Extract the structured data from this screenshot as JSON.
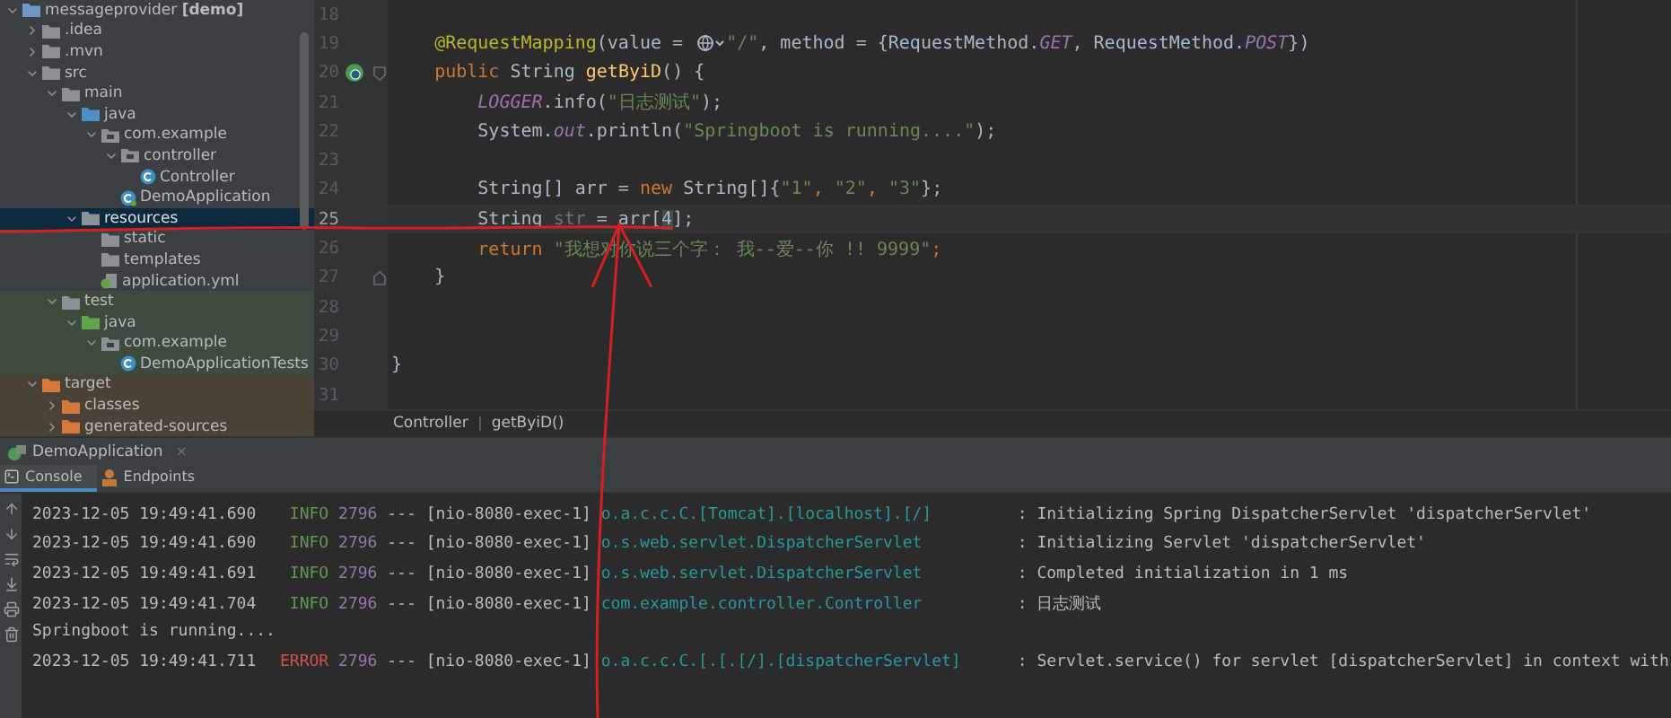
{
  "project_tree": [
    {
      "label": "messageprovider **[demo]**",
      "kind": "module",
      "expanded": true,
      "selected": false,
      "children": [
        {
          "label": ".idea",
          "kind": "folder",
          "expanded": false,
          "selected": false
        },
        {
          "label": ".mvn",
          "kind": "folder",
          "expanded": false,
          "selected": false
        },
        {
          "label": "src",
          "kind": "folder",
          "expanded": true,
          "selected": false,
          "children": [
            {
              "label": "main",
              "kind": "folder",
              "expanded": true,
              "selected": false,
              "children": [
                {
                  "label": "java",
                  "kind": "source-folder",
                  "expanded": true,
                  "selected": false,
                  "children": [
                    {
                      "label": "com.example",
                      "kind": "package",
                      "expanded": true,
                      "selected": false,
                      "children": [
                        {
                          "label": "controller",
                          "kind": "package",
                          "expanded": true,
                          "selected": false,
                          "children": [
                            {
                              "label": "Controller",
                              "kind": "class",
                              "selected": false
                            }
                          ]
                        },
                        {
                          "label": "DemoApplication",
                          "kind": "app-class",
                          "selected": false
                        }
                      ]
                    }
                  ]
                },
                {
                  "label": "resources",
                  "kind": "resource-folder",
                  "expanded": true,
                  "selected": true,
                  "children": [
                    {
                      "label": "static",
                      "kind": "folder",
                      "selected": false
                    },
                    {
                      "label": "templates",
                      "kind": "folder",
                      "selected": false
                    },
                    {
                      "label": "application.yml",
                      "kind": "yaml",
                      "selected": false
                    }
                  ]
                }
              ]
            },
            {
              "label": "test",
              "kind": "folder",
              "test_scope": true,
              "expanded": true,
              "selected": false,
              "children": [
                {
                  "label": "java",
                  "kind": "test-folder",
                  "expanded": true,
                  "selected": false,
                  "children": [
                    {
                      "label": "com.example",
                      "kind": "package",
                      "expanded": true,
                      "selected": false,
                      "children": [
                        {
                          "label": "DemoApplicationTests",
                          "kind": "class",
                          "selected": false
                        }
                      ]
                    }
                  ]
                }
              ]
            }
          ]
        },
        {
          "label": "target",
          "kind": "excluded-folder",
          "excluded": true,
          "expanded": true,
          "selected": false,
          "children": [
            {
              "label": "classes",
              "kind": "excluded-folder",
              "expanded": false,
              "selected": false
            },
            {
              "label": "generated-sources",
              "kind": "excluded-folder",
              "expanded": false,
              "selected": false
            }
          ]
        }
      ]
    }
  ],
  "editor": {
    "lines": [
      {
        "number": "18",
        "current": false
      },
      {
        "number": "19",
        "current": false,
        "segments": [
          {
            "kind": "annotation",
            "text": "    @RequestMapping"
          },
          {
            "kind": "plain",
            "text": "(value = "
          },
          {
            "kind": "globe-icon"
          },
          {
            "kind": "string",
            "text": "\"/\""
          },
          {
            "kind": "plain",
            "text": ", method = {RequestMethod."
          },
          {
            "kind": "constant",
            "text": "GET"
          },
          {
            "kind": "plain",
            "text": ", RequestMethod."
          },
          {
            "kind": "constant",
            "text": "POST"
          },
          {
            "kind": "plain",
            "text": "})"
          }
        ]
      },
      {
        "number": "20",
        "current": false,
        "run_icon": true,
        "fold_start": true,
        "segments": [
          {
            "kind": "keyword",
            "text": "    public "
          },
          {
            "kind": "plain",
            "text": "String "
          },
          {
            "kind": "method",
            "text": "getByiD"
          },
          {
            "kind": "plain",
            "text": "() {"
          }
        ]
      },
      {
        "number": "21",
        "current": false,
        "segments": [
          {
            "kind": "constant",
            "text": "        LOGGER"
          },
          {
            "kind": "plain",
            "text": ".info("
          },
          {
            "kind": "string",
            "text": "\"日志测试\""
          },
          {
            "kind": "plain",
            "text": ");"
          }
        ]
      },
      {
        "number": "22",
        "current": false,
        "segments": [
          {
            "kind": "plain",
            "text": "        System."
          },
          {
            "kind": "field",
            "text": "out"
          },
          {
            "kind": "plain",
            "text": ".println("
          },
          {
            "kind": "string",
            "text": "\"Springboot is running....\""
          },
          {
            "kind": "plain",
            "text": ");"
          }
        ]
      },
      {
        "number": "23",
        "current": false
      },
      {
        "number": "24",
        "current": false,
        "segments": [
          {
            "kind": "plain",
            "text": "        String[] arr = "
          },
          {
            "kind": "keyword",
            "text": "new "
          },
          {
            "kind": "plain",
            "text": "String[]{"
          },
          {
            "kind": "string",
            "text": "\"1\""
          },
          {
            "kind": "keyword",
            "text": ", "
          },
          {
            "kind": "string",
            "text": "\"2\""
          },
          {
            "kind": "keyword",
            "text": ", "
          },
          {
            "kind": "string",
            "text": "\"3\""
          },
          {
            "kind": "plain",
            "text": "};"
          }
        ]
      },
      {
        "number": "25",
        "current": true,
        "segments": [
          {
            "kind": "plain",
            "text": "        String "
          },
          {
            "kind": "unused",
            "text": "str"
          },
          {
            "kind": "plain",
            "text": " = arr["
          },
          {
            "kind": "caret",
            "text": "4"
          },
          {
            "kind": "plain",
            "text": "];"
          }
        ]
      },
      {
        "number": "26",
        "current": false,
        "segments": [
          {
            "kind": "keyword",
            "text": "        return "
          },
          {
            "kind": "string",
            "text": "\"我想对你说三个字： 我--爱--你 !! 9999\""
          },
          {
            "kind": "keyword",
            "text": ";"
          }
        ]
      },
      {
        "number": "27",
        "current": false,
        "fold_end": true,
        "segments": [
          {
            "kind": "plain",
            "text": "    }"
          }
        ]
      },
      {
        "number": "28",
        "current": false
      },
      {
        "number": "29",
        "current": false
      },
      {
        "number": "30",
        "current": false,
        "segments": [
          {
            "kind": "plain",
            "text": "}"
          }
        ]
      },
      {
        "number": "31",
        "current": false
      }
    ],
    "breadcrumbs": [
      "Controller",
      "getByiD()"
    ]
  },
  "run_panel": {
    "tab": {
      "label": "DemoApplication",
      "close": "×"
    },
    "tabs": [
      {
        "label": "Console",
        "selected": true
      },
      {
        "label": "Endpoints",
        "selected": false
      }
    ],
    "console_lines": [
      {
        "kind": "log",
        "time": "2023-12-05 19:49:41.690",
        "level": "INFO",
        "pid": "2796",
        "sep": "---",
        "thread": "[nio-8080-exec-1]",
        "logger": "o.a.c.c.C.[Tomcat].[localhost].[/]",
        "message": ": Initializing Spring DispatcherServlet 'dispatcherServlet'"
      },
      {
        "kind": "log",
        "time": "2023-12-05 19:49:41.690",
        "level": "INFO",
        "pid": "2796",
        "sep": "---",
        "thread": "[nio-8080-exec-1]",
        "logger": "o.s.web.servlet.DispatcherServlet",
        "message": ": Initializing Servlet 'dispatcherServlet'"
      },
      {
        "kind": "log",
        "time": "2023-12-05 19:49:41.691",
        "level": "INFO",
        "pid": "2796",
        "sep": "---",
        "thread": "[nio-8080-exec-1]",
        "logger": "o.s.web.servlet.DispatcherServlet",
        "message": ": Completed initialization in 1 ms"
      },
      {
        "kind": "log",
        "time": "2023-12-05 19:49:41.704",
        "level": "INFO",
        "pid": "2796",
        "sep": "---",
        "thread": "[nio-8080-exec-1]",
        "logger": "com.example.controller.Controller",
        "message": ": 日志测试"
      },
      {
        "kind": "plain",
        "text": "Springboot is running...."
      },
      {
        "kind": "log",
        "time": "2023-12-05 19:49:41.711",
        "level": "ERROR",
        "pid": "2796",
        "sep": "---",
        "thread": "[nio-8080-exec-1]",
        "logger": "o.a.c.c.C.[.[.[/].[dispatcherServlet]",
        "message": ": Servlet.service() for servlet [dispatcherServlet] in context with"
      }
    ]
  }
}
